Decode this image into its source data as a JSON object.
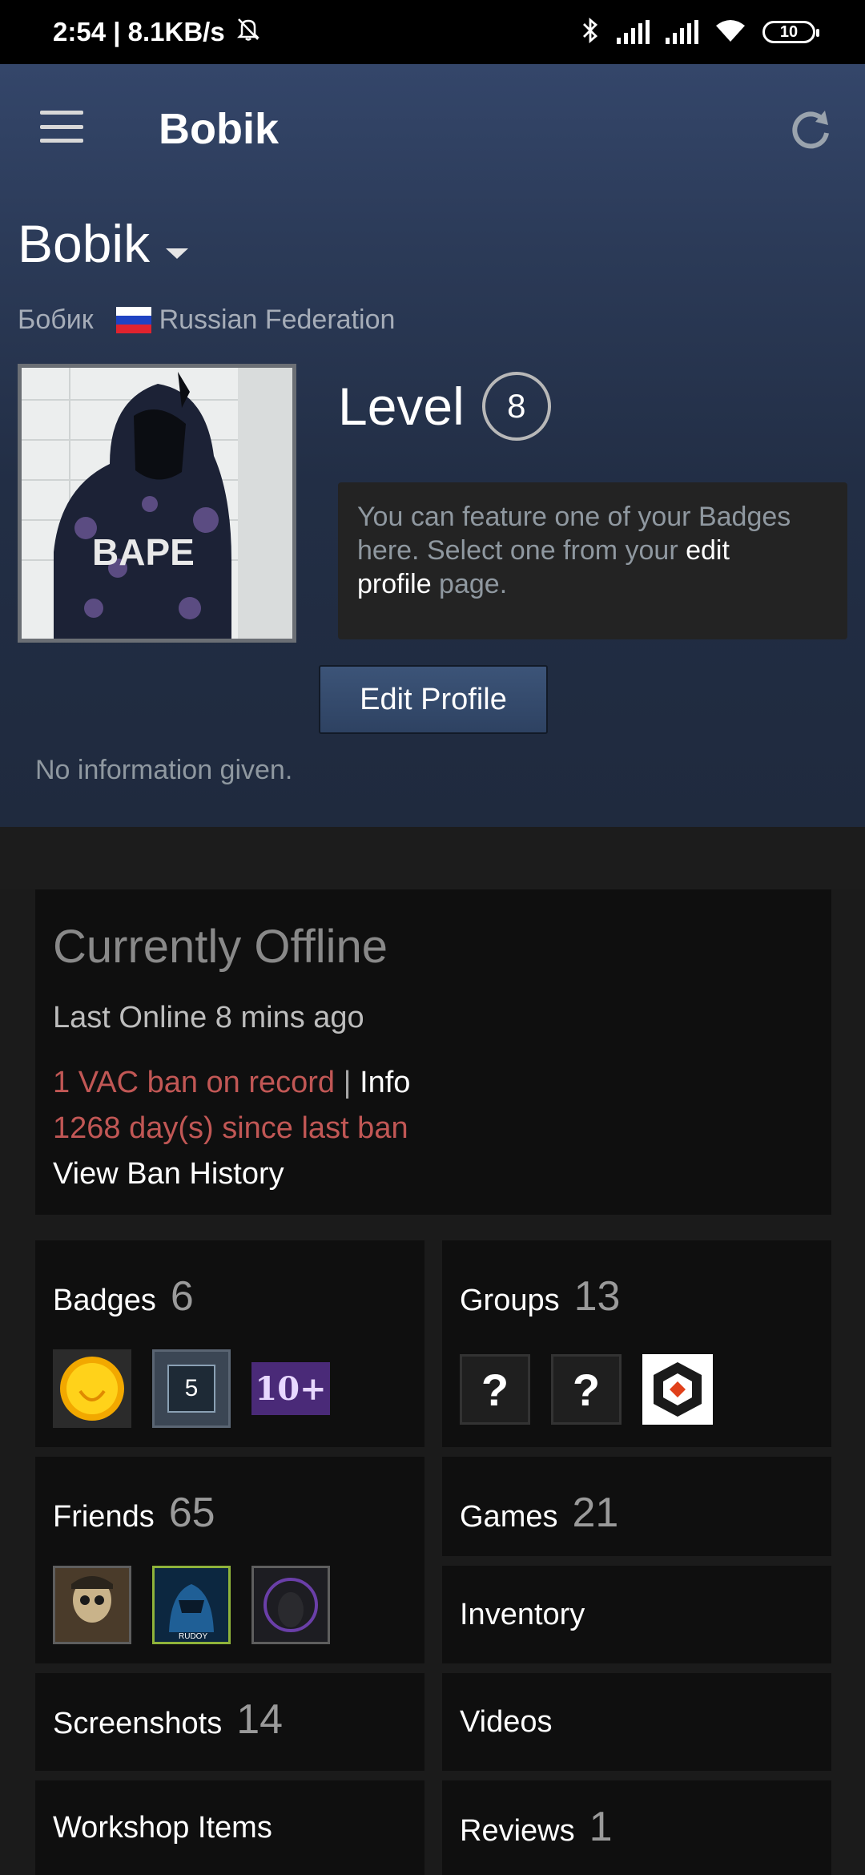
{
  "status_bar": {
    "time_speed": "2:54 | 8.1KB/s",
    "battery": "10",
    "icons": [
      "bell-off-icon",
      "bluetooth-icon",
      "signal-icon",
      "signal-icon",
      "wifi-icon",
      "battery-icon"
    ]
  },
  "app_bar": {
    "title": "Bobik",
    "menu_icon": "menu-icon",
    "refresh_icon": "refresh-icon"
  },
  "profile": {
    "persona_name": "Bobik",
    "real_name": "Бобик",
    "country": "Russian Federation",
    "avatar_text": "BAPE",
    "level_label": "Level",
    "level": "8",
    "badge_prompt": {
      "text_before": "You can feature one of your Badges here. Select one from your ",
      "link_edit": "edit",
      "link_profile": "profile",
      "text_after": " page."
    },
    "edit_button": "Edit Profile",
    "summary": "No information given."
  },
  "status": {
    "title": "Currently Offline",
    "last_online": "Last Online 8 mins ago",
    "vac": "1 VAC ban on record",
    "separator": "|",
    "info_link": "Info",
    "days_since": "1268 day(s) since last ban",
    "history_link": "View Ban History"
  },
  "tiles": {
    "badges": {
      "label": "Badges",
      "count": "6",
      "thumb_text": [
        "5",
        "10+"
      ]
    },
    "groups": {
      "label": "Groups",
      "count": "13",
      "thumb_text": [
        "?",
        "?"
      ]
    },
    "friends": {
      "label": "Friends",
      "count": "65",
      "thumb_text": [
        "RUDOY"
      ]
    },
    "games": {
      "label": "Games",
      "count": "21"
    },
    "inventory": {
      "label": "Inventory"
    },
    "screenshots": {
      "label": "Screenshots",
      "count": "14"
    },
    "videos": {
      "label": "Videos"
    },
    "workshop": {
      "label": "Workshop Items"
    },
    "reviews": {
      "label": "Reviews",
      "count": "1"
    }
  },
  "colors": {
    "header_top": "#34466a",
    "header_bottom": "#1f2a3e",
    "ban_red": "#c15755",
    "tile_bg": "#0f0f0f",
    "page_bg": "#1b1b1b",
    "muted_text": "#8f98a0"
  }
}
